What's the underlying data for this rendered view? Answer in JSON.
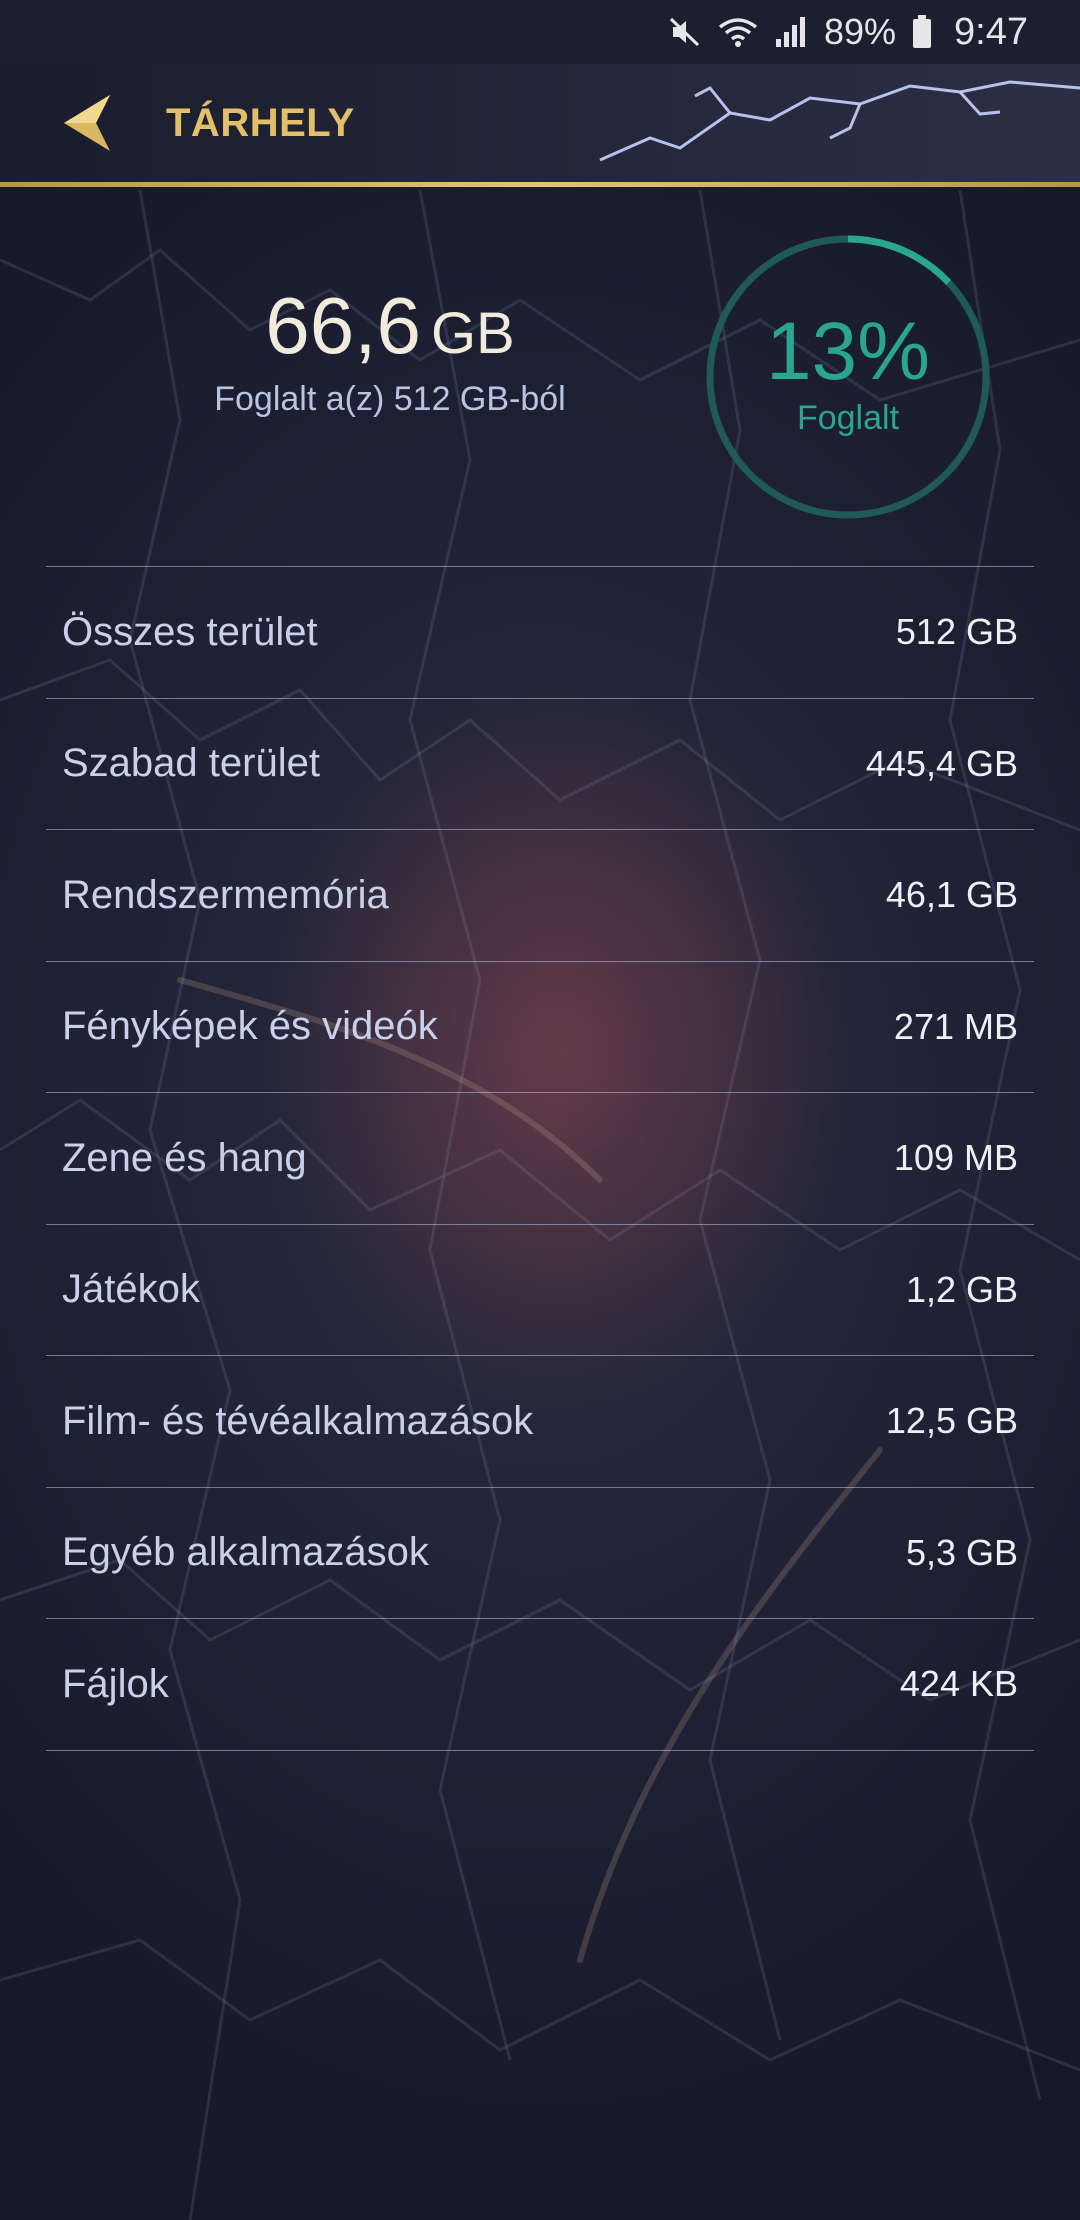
{
  "status_bar": {
    "battery_percent": "89%",
    "time": "9:47",
    "icons": [
      "mute-icon",
      "wifi-icon",
      "signal-icon",
      "battery-icon"
    ]
  },
  "app_bar": {
    "title": "TÁRHELY",
    "back_icon": "back-arrow-icon"
  },
  "summary": {
    "used_value": "66,6",
    "used_unit": "GB",
    "used_caption": "Foglalt a(z) 512 GB-ból",
    "percent_text": "13%",
    "percent_label": "Foglalt",
    "used_fraction": 0.13
  },
  "items": [
    {
      "label": "Összes terület",
      "value": "512 GB"
    },
    {
      "label": "Szabad terület",
      "value": "445,4 GB"
    },
    {
      "label": "Rendszermemória",
      "value": "46,1 GB"
    },
    {
      "label": "Fényképek és videók",
      "value": "271 MB"
    },
    {
      "label": "Zene és hang",
      "value": "109 MB"
    },
    {
      "label": "Játékok",
      "value": "1,2 GB"
    },
    {
      "label": "Film- és tévéalkalmazások",
      "value": "12,5 GB"
    },
    {
      "label": "Egyéb alkalmazások",
      "value": "5,3 GB"
    },
    {
      "label": "Fájlok",
      "value": "424 KB"
    }
  ],
  "colors": {
    "accent_gold": "#e2c06a",
    "ring_teal": "#2aa590",
    "ring_track": "#1f5a57"
  }
}
